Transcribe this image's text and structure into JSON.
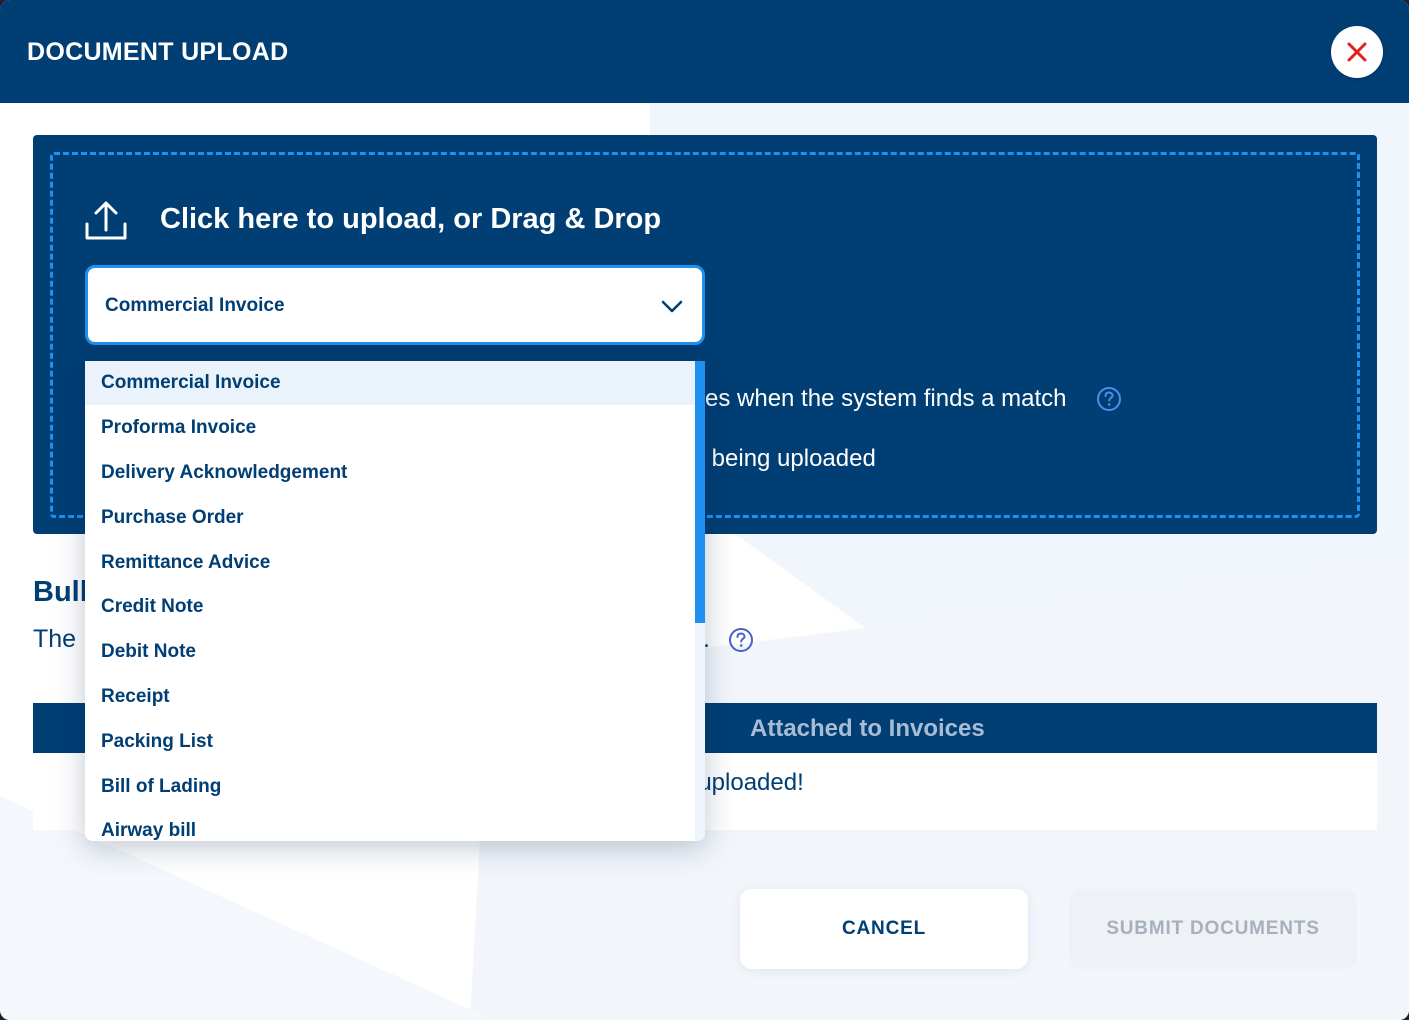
{
  "header": {
    "title": "DOCUMENT UPLOAD"
  },
  "upload": {
    "prompt": "Click here to upload, or Drag & Drop",
    "document_type": {
      "selected": "Commercial Invoice"
    },
    "visible_line_1": "ces when the system finds a match",
    "visible_line_2": "s being uploaded"
  },
  "dropdown": {
    "options": [
      "Commercial Invoice",
      "Proforma Invoice",
      "Delivery Acknowledgement",
      "Purchase Order",
      "Remittance Advice",
      "Credit Note",
      "Debit Note",
      "Receipt",
      "Packing List",
      "Bill of Lading",
      "Airway bill"
    ],
    "selected_index": 0
  },
  "bulk": {
    "title_visible": "Bull",
    "description_visible_start": "The",
    "description_visible_end": "."
  },
  "table": {
    "column_attached": "Attached to Invoices",
    "empty_message_visible": "ts uploaded!"
  },
  "actions": {
    "cancel_label": "CANCEL",
    "submit_label": "SUBMIT DOCUMENTS"
  },
  "colors": {
    "primary": "#003e74",
    "accent": "#1e90ef",
    "close_icon": "#e02020",
    "disabled_text": "#a7b0bd"
  },
  "icons": {
    "close": "close-icon",
    "upload": "upload-icon",
    "chevron": "chevron-down-icon",
    "help": "help-circle-icon"
  }
}
